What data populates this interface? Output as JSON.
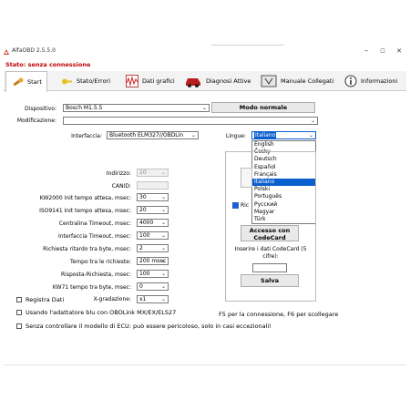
{
  "window": {
    "title": "AlfaOBD 2.5.5.0",
    "minimize": "–",
    "maximize": "☐",
    "close": "✕"
  },
  "status": "Stato: senza connessione",
  "tabs": [
    {
      "label": "Start",
      "icon": "wrench-icon"
    },
    {
      "label": "Stato/Errori",
      "icon": "key-icon"
    },
    {
      "label": "Dati grafici",
      "icon": "waveform-icon"
    },
    {
      "label": "Diagnosi Attive",
      "icon": "car-icon"
    },
    {
      "label": "Manuale Collegati",
      "icon": "manual-icon"
    },
    {
      "label": "Informazioni",
      "icon": "info-icon"
    }
  ],
  "form": {
    "dispositivo_label": "Dispositivo:",
    "dispositivo_value": "Bosch M1.5.5",
    "modalita_button": "Modo normale",
    "modificazione_label": "Modificazione:",
    "modificazione_value": "",
    "interfaccia_label": "Interfaccia:",
    "interfaccia_value": "Bluetooth ELM327//OBDLin",
    "lingue_label": "Lingue:",
    "lingue_value": "Italiano"
  },
  "language_options": [
    "English",
    "Česky",
    "Deutsch",
    "Español",
    "Français",
    "Italiano",
    "Polski",
    "Português",
    "Русский",
    "Magyar",
    "Türk"
  ],
  "language_selected_index": 5,
  "params": [
    {
      "label": "Indirizzo:",
      "value": "10",
      "disabled": true
    },
    {
      "label": "CANID:",
      "value": "",
      "disabled": true,
      "no_arrow": true
    },
    {
      "label": "KW2000 Init tempo attesa, msec:",
      "value": "30"
    },
    {
      "label": "ISO9141 Init tempo attesa, msec:",
      "value": "20"
    },
    {
      "label": "Centralina Timeout, msec:",
      "value": "4000"
    },
    {
      "label": "Interfaccia Timeout, msec:",
      "value": "100"
    },
    {
      "label": "Richiesta ritardo tra byte, msec:",
      "value": "2"
    },
    {
      "label": "Tempo tra le richieste:",
      "value": "200 msec"
    },
    {
      "label": "Risposta-Richiesta, msec:",
      "value": "100"
    },
    {
      "label": "KW71 tempo tra byte, msec:",
      "value": "0"
    }
  ],
  "registra": {
    "label": "Registra Dati",
    "xgrad_label": "X-gradazione:",
    "xgrad_value": "x1"
  },
  "options": [
    "Usando l'adattatore blu con OBDLink MX/EX/ELS27",
    "Senza controllare il modello di ECU: può essere pericoloso, solo in casi eccezionali!"
  ],
  "right_panel": {
    "ric_label": "Ric",
    "access_button": "Accesso con CodeCard",
    "codecard_text": "Inserire i dati CodeCard (5 cifre):",
    "codecard_value": "",
    "save_button": "Salva",
    "hint": "F5 per la connessione, F6 per scollegare"
  }
}
